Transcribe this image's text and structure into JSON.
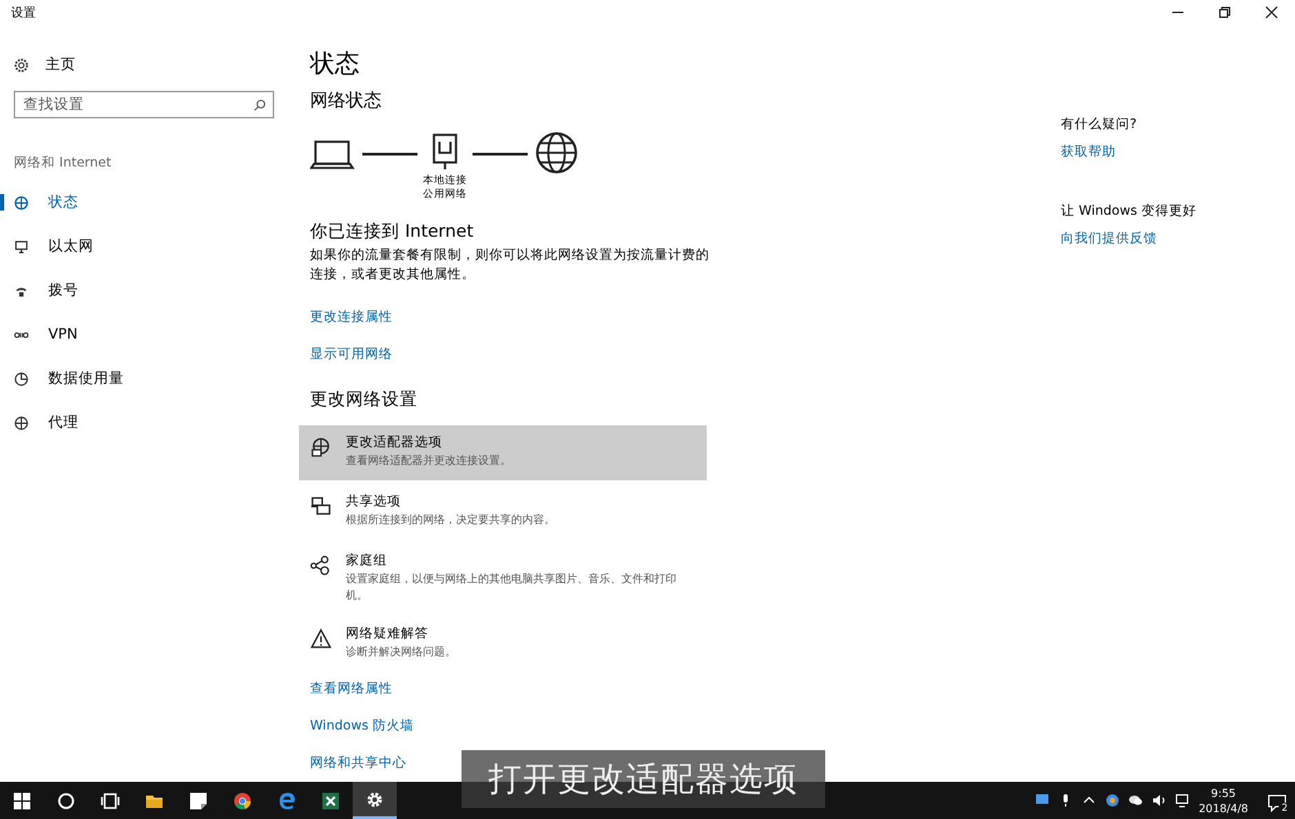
{
  "window": {
    "title": "设置"
  },
  "sidebar": {
    "home": "主页",
    "search": {
      "placeholder": "查找设置"
    },
    "section": "网络和 Internet",
    "items": [
      {
        "kind": "status",
        "label": "状态",
        "selected": true
      },
      {
        "kind": "ethernet",
        "label": "以太网",
        "selected": false
      },
      {
        "kind": "dialup",
        "label": "拨号",
        "selected": false
      },
      {
        "kind": "vpn",
        "label": "VPN",
        "selected": false
      },
      {
        "kind": "datausage",
        "label": "数据使用量",
        "selected": false
      },
      {
        "kind": "proxy",
        "label": "代理",
        "selected": false
      }
    ]
  },
  "main": {
    "title": "状态",
    "network_status": {
      "heading": "网络状态",
      "connection_name": "本地连接",
      "network_type": "公用网络"
    },
    "connected": {
      "heading": "你已连接到 Internet",
      "description": "如果你的流量套餐有限制，则你可以将此网络设置为按流量计费的连接，或者更改其他属性。"
    },
    "links": [
      "更改连接属性",
      "显示可用网络"
    ],
    "change_heading": "更改网络设置",
    "options": [
      {
        "kind": "adapter",
        "title": "更改适配器选项",
        "description": "查看网络适配器并更改连接设置。",
        "selected": true
      },
      {
        "kind": "sharing",
        "title": "共享选项",
        "description": "根据所连接到的网络，决定要共享的内容。",
        "selected": false
      },
      {
        "kind": "homegroup",
        "title": "家庭组",
        "description": "设置家庭组，以便与网络上的其他电脑共享图片、音乐、文件和打印机。",
        "selected": false
      },
      {
        "kind": "troubleshoot",
        "title": "网络疑难解答",
        "description": "诊断并解决网络问题。",
        "selected": false
      }
    ],
    "bottom_links": [
      "查看网络属性",
      "Windows 防火墙",
      "网络和共享中心"
    ]
  },
  "right": {
    "help_heading": "有什么疑问?",
    "help_link": "获取帮助",
    "feedback_heading": "让 Windows 变得更好",
    "feedback_link": "向我们提供反馈"
  },
  "caption": "打开更改适配器选项",
  "taskbar": {
    "apps": [
      {
        "kind": "start",
        "selected": false
      },
      {
        "kind": "cortana",
        "selected": false
      },
      {
        "kind": "taskview",
        "selected": false
      },
      {
        "kind": "explorer",
        "selected": false
      },
      {
        "kind": "notes",
        "selected": false
      },
      {
        "kind": "chrome",
        "selected": false
      },
      {
        "kind": "edge",
        "selected": false
      },
      {
        "kind": "excel",
        "selected": false
      },
      {
        "kind": "settings",
        "selected": true
      }
    ],
    "time": "9:55",
    "date": "2018/4/8",
    "notifications": "2"
  }
}
